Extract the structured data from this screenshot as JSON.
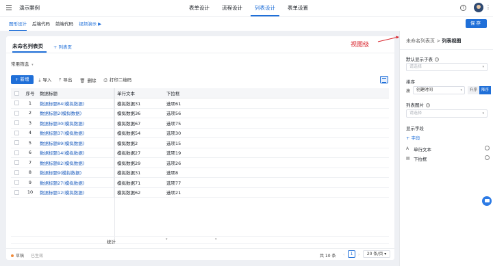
{
  "header": {
    "app_title": "演示案例",
    "tabs": [
      {
        "label": "表单设计"
      },
      {
        "label": "流程设计"
      },
      {
        "label": "列表设计",
        "active": true
      },
      {
        "label": "表单设置"
      }
    ],
    "help_glyph": "?",
    "more_glyph": "⋮"
  },
  "subbar": {
    "tabs": [
      {
        "label": "图形设计",
        "active": true
      },
      {
        "label": "后端代码"
      },
      {
        "label": "前端代码"
      },
      {
        "label": "视频演示 ▶",
        "link": true
      }
    ],
    "save_label": "保存"
  },
  "list_card": {
    "title": "未命名列表页",
    "add_list": "+ 列表页",
    "filter_label": "常用筛选",
    "filter_caret": "▾",
    "toolbar": {
      "new_label": "+ 新增",
      "import_label": "导入",
      "export_label": "导出",
      "delete_label": "删除",
      "print_qr_label": "打印二维码"
    },
    "columns": {
      "no": "序号",
      "title": "数据标题",
      "text": "单行文本",
      "pick": "下拉框"
    },
    "rows": [
      {
        "no": "1",
        "title": "数据标题84(模拟数据)",
        "text": "模拟数据31",
        "pick": "选项61"
      },
      {
        "no": "2",
        "title": "数据标题2(模拟数据)",
        "text": "模拟数据36",
        "pick": "选项56"
      },
      {
        "no": "3",
        "title": "数据标题30(模拟数据)",
        "text": "模拟数据67",
        "pick": "选项75"
      },
      {
        "no": "4",
        "title": "数据标题37(模拟数据)",
        "text": "模拟数据54",
        "pick": "选项30"
      },
      {
        "no": "5",
        "title": "数据标题89(模拟数据)",
        "text": "模拟数据2",
        "pick": "选项15"
      },
      {
        "no": "6",
        "title": "数据标题14(模拟数据)",
        "text": "模拟数据27",
        "pick": "选项19"
      },
      {
        "no": "7",
        "title": "数据标题82(模拟数据)",
        "text": "模拟数据29",
        "pick": "选项26"
      },
      {
        "no": "8",
        "title": "数据标题9(模拟数据)",
        "text": "模拟数据31",
        "pick": "选项8"
      },
      {
        "no": "9",
        "title": "数据标题27(模拟数据)",
        "text": "模拟数据71",
        "pick": "选项77"
      },
      {
        "no": "10",
        "title": "数据标题12(模拟数据)",
        "text": "模拟数据62",
        "pick": "选项21"
      }
    ],
    "stat_label": "统计",
    "footer": {
      "status_draft": "草稿",
      "status_inactive": "已生效",
      "total": "共 10 条",
      "prev": "‹",
      "page": "1",
      "next": "›",
      "page_size": "20 条/页 ▾"
    }
  },
  "annotation": {
    "text": "视图级"
  },
  "right_panel": {
    "crumb_parent": "未命名列表页",
    "crumb_sep": " > ",
    "crumb_current": "列表视图",
    "default_child_label": "默认显示子表",
    "default_child_placeholder": "请选择",
    "sort_label": "排序",
    "sort_by": "按",
    "sort_field": "创建时间",
    "sort_asc": "升序",
    "sort_desc": "降序",
    "list_image_label": "列表图片",
    "list_image_placeholder": "请选择",
    "display_fields_label": "显示字段",
    "add_field": "+ 字段",
    "fields": [
      {
        "label": "单行文本",
        "icon": "A"
      },
      {
        "label": "下拉框",
        "icon": "▤"
      }
    ],
    "caret": "▾"
  },
  "colors": {
    "accent": "#1f6fd8",
    "annotation": "#d9262e"
  }
}
